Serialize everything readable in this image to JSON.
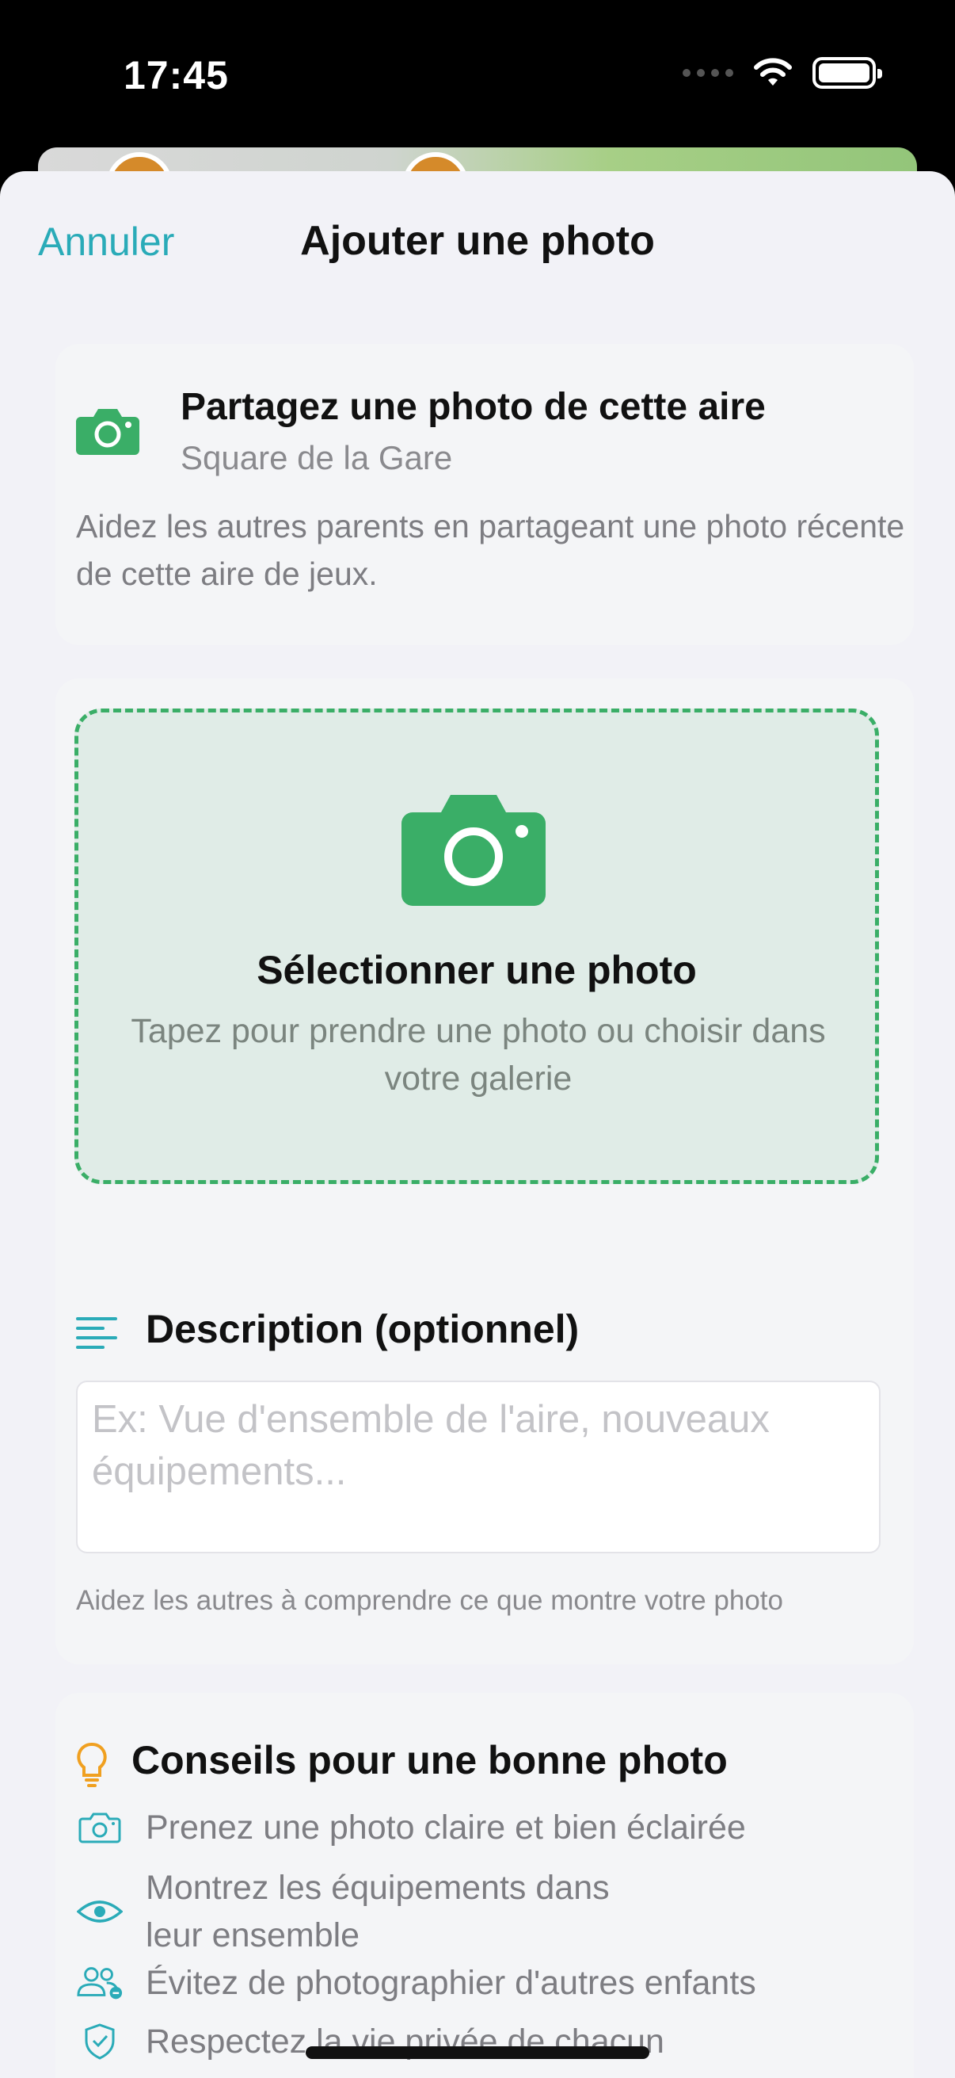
{
  "status": {
    "time": "17:45"
  },
  "nav": {
    "cancel": "Annuler",
    "title": "Ajouter une photo"
  },
  "intro": {
    "title": "Partagez une photo de cette aire",
    "subtitle": "Square de la Gare",
    "description": "Aidez les autres parents en partageant une photo récente de cette aire de jeux."
  },
  "dropzone": {
    "title": "Sélectionner une photo",
    "subtitle": "Tapez pour prendre une photo ou choisir dans votre galerie"
  },
  "description_field": {
    "title": "Description (optionnel)",
    "placeholder": "Ex: Vue d'ensemble de l'aire, nouveaux équipements...",
    "helper": "Aidez les autres à comprendre ce que montre votre photo"
  },
  "tips": {
    "title": "Conseils pour une bonne photo",
    "items": [
      {
        "icon": "camera-icon",
        "text": "Prenez une photo claire et bien éclairée"
      },
      {
        "icon": "eye-icon",
        "text": "Montrez les équipements dans leur ensemble"
      },
      {
        "icon": "people-icon",
        "text": "Évitez de photographier d'autres enfants"
      },
      {
        "icon": "shield-icon",
        "text": "Respectez la vie privée de chacun"
      }
    ]
  },
  "colors": {
    "accent": "#2aabb8",
    "green": "#3aae67",
    "tip_orange": "#f0a020"
  }
}
